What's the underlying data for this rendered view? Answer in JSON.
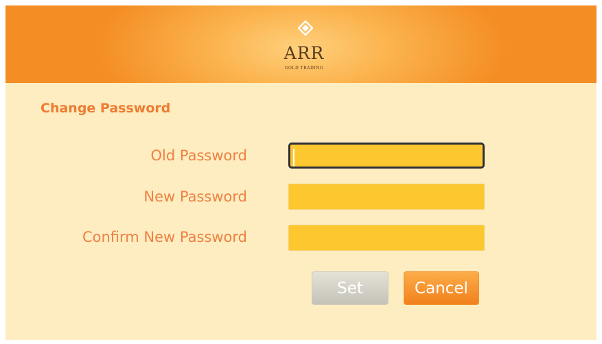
{
  "header": {
    "brand": "ARR",
    "brand_sub": "GOLD TRADING",
    "logo_icon": "diamond-icon"
  },
  "form": {
    "title": "Change Password",
    "fields": [
      {
        "label": "Old Password",
        "value": "",
        "focused": true
      },
      {
        "label": "New Password",
        "value": ""
      },
      {
        "label": "Confirm New Password",
        "value": ""
      }
    ]
  },
  "buttons": {
    "set_label": "Set",
    "set_enabled": false,
    "cancel_label": "Cancel"
  },
  "colors": {
    "header_orange": "#f48d24",
    "panel_background": "#fdedc0",
    "accent_text": "#ef7c33",
    "input_yellow": "#fdc72f",
    "cancel_button": "#f1811d",
    "disabled_button": "#c5c2b8"
  }
}
